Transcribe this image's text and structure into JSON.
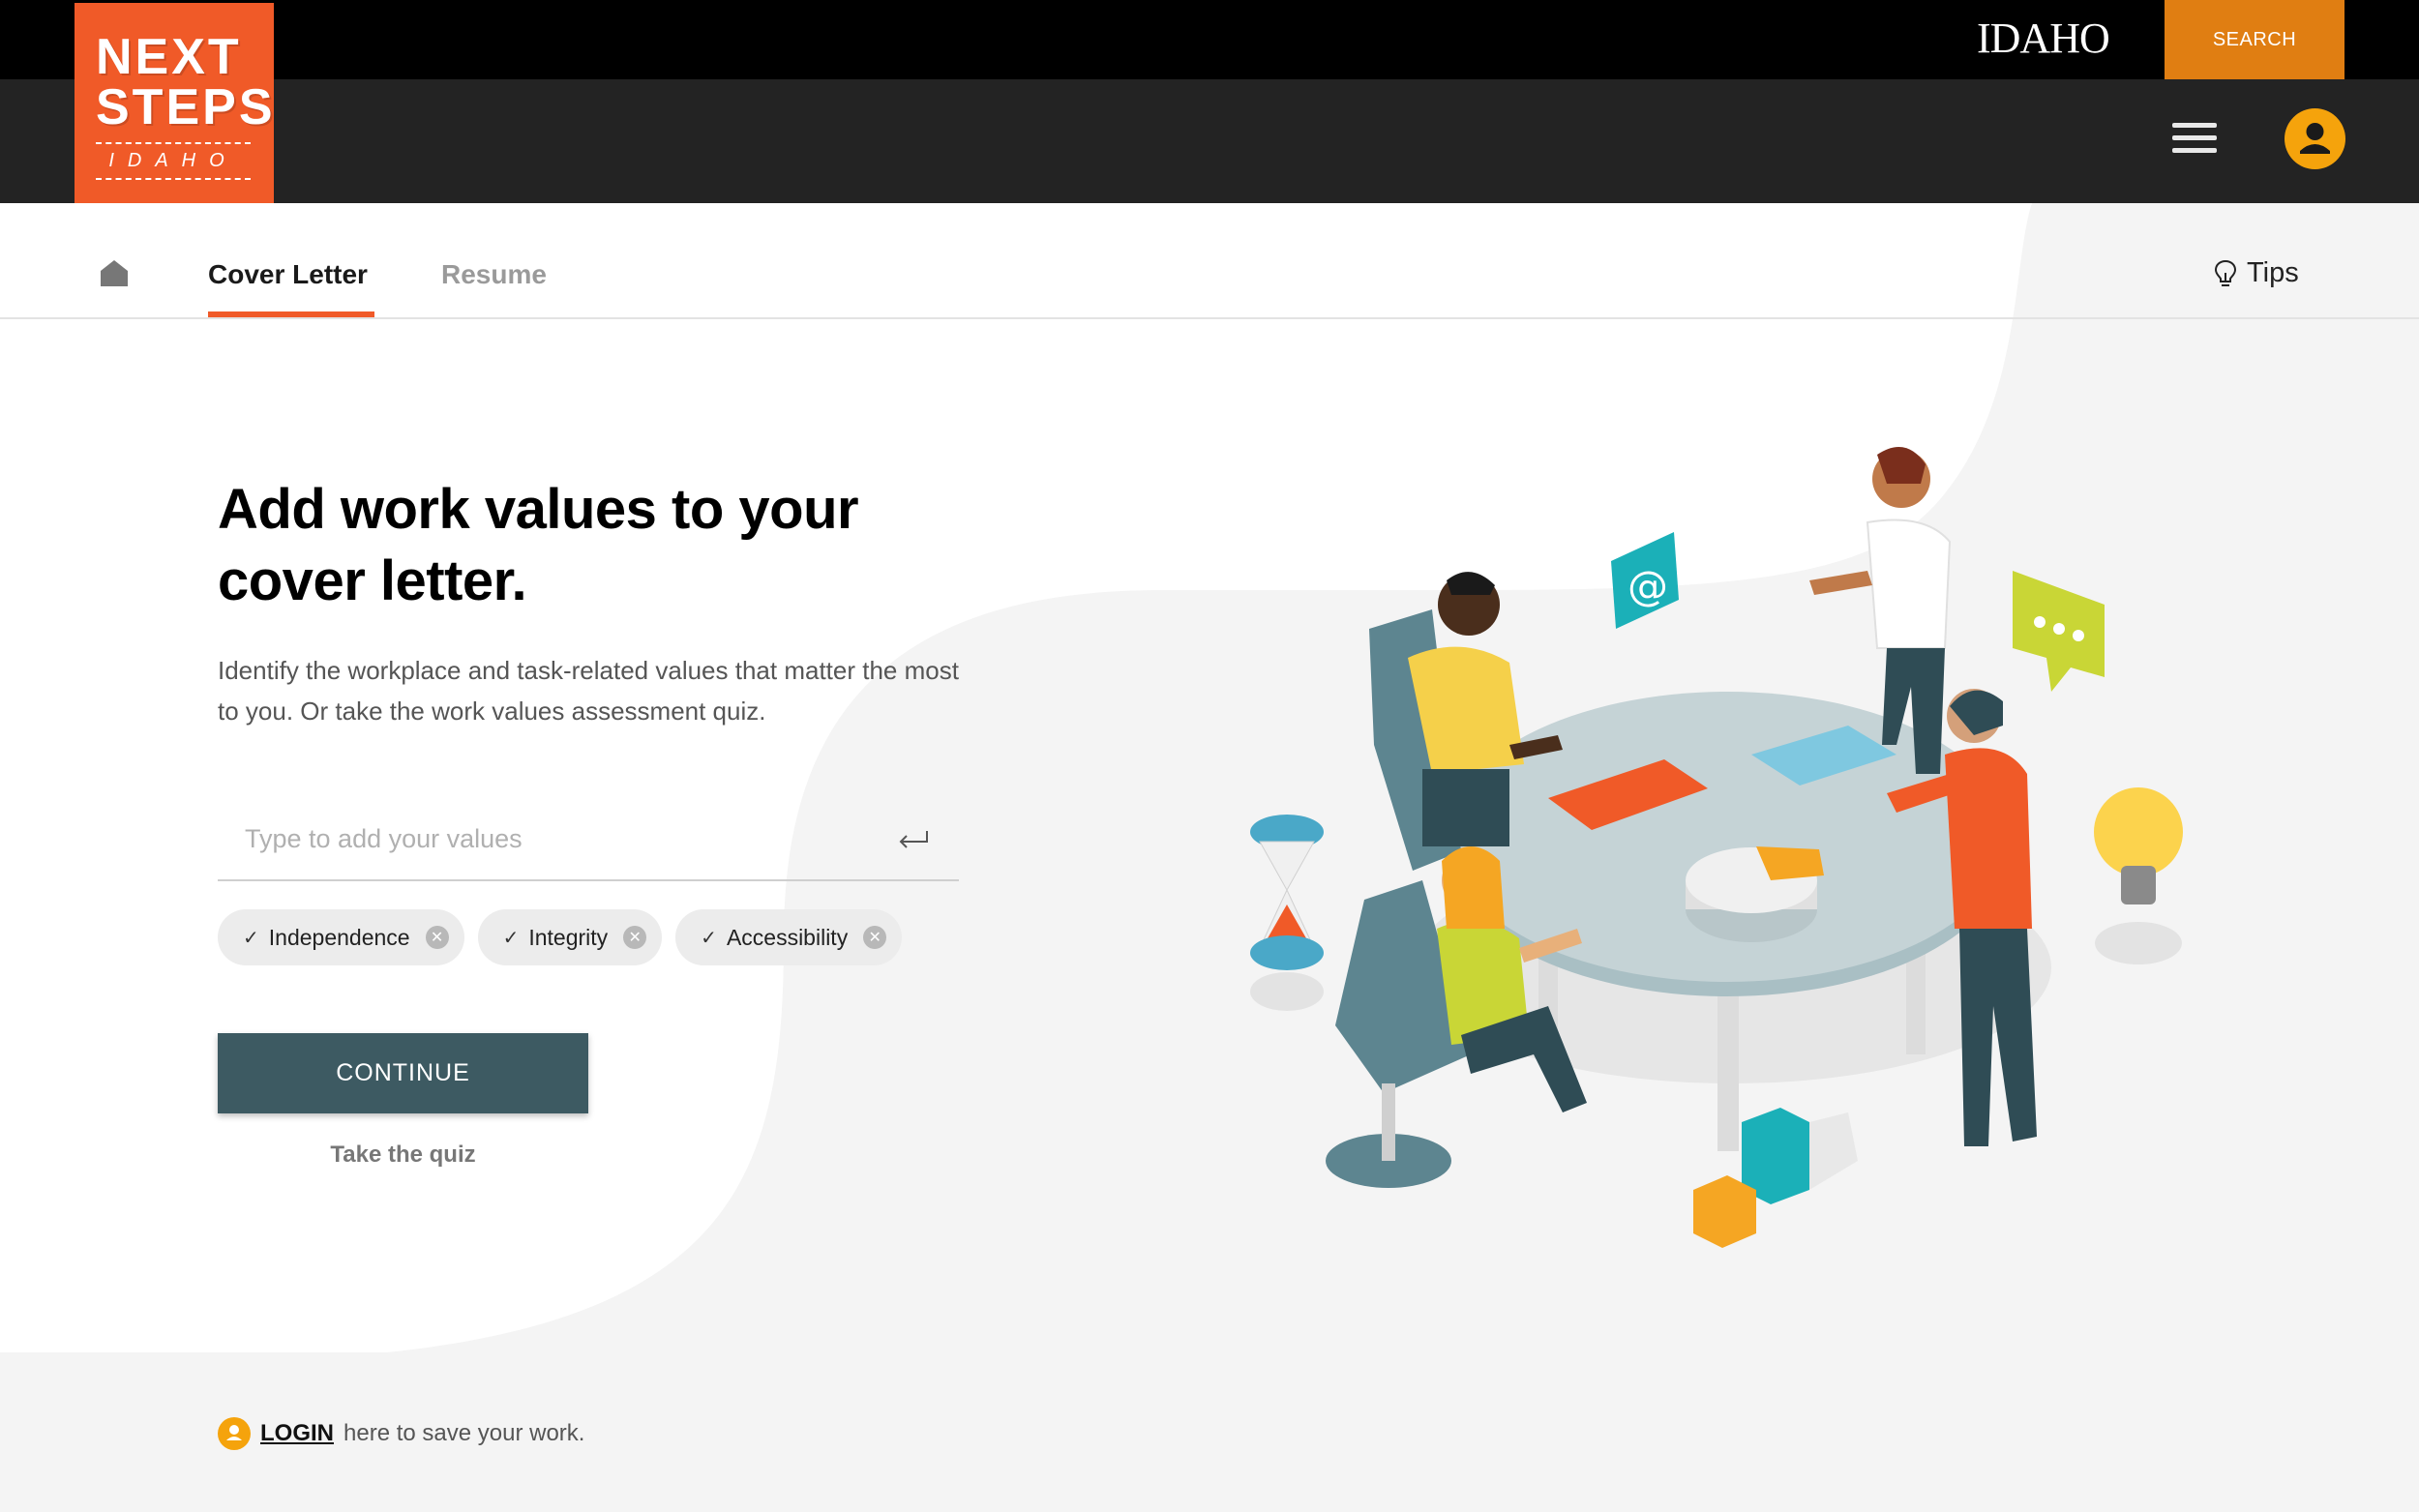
{
  "topbar": {
    "state_brand": "IDAHO",
    "search_label": "SEARCH"
  },
  "logo": {
    "line1": "NEXT",
    "line2": "STEPS",
    "line3": "IDAHO"
  },
  "tabs": {
    "cover_letter": "Cover Letter",
    "resume": "Resume",
    "tips": "Tips"
  },
  "main": {
    "title": "Add work values to your cover letter.",
    "subtitle": "Identify the workplace and task-related values that matter the most to you. Or take the work values assessment quiz.",
    "input_placeholder": "Type to add your values",
    "chips": [
      "Independence",
      "Integrity",
      "Accessibility"
    ],
    "continue_label": "CONTINUE",
    "quiz_label": "Take the quiz"
  },
  "footer": {
    "login_label": "LOGIN",
    "login_suffix": "here to save your work."
  },
  "colors": {
    "brand_orange": "#f05a28",
    "search_orange": "#e07e12",
    "avatar_yellow": "#f5a30c",
    "button_teal": "#3d5a62"
  }
}
